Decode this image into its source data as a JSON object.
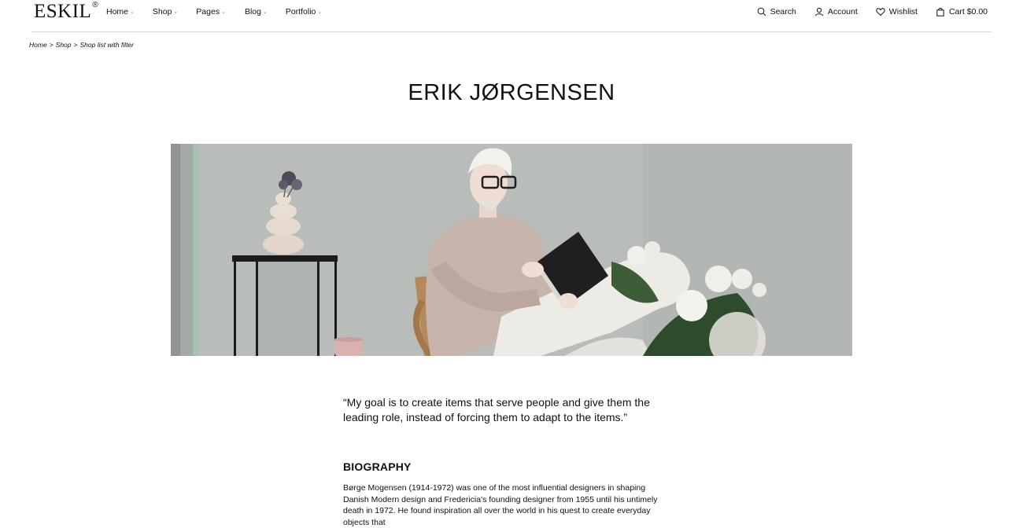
{
  "header": {
    "logo": "ESKIL",
    "logo_mark": "®",
    "nav": [
      {
        "label": "Home"
      },
      {
        "label": "Shop"
      },
      {
        "label": "Pages"
      },
      {
        "label": "Blog"
      },
      {
        "label": "Portfolio"
      }
    ],
    "utility": {
      "search": "Search",
      "account": "Account",
      "wishlist": "Wishlist",
      "cart": "Cart $0.00"
    }
  },
  "breadcrumb": [
    "Home",
    "Shop",
    "Shop list with filter"
  ],
  "breadcrumb_separator": ">",
  "page": {
    "title": "ERIK JØRGENSEN",
    "quote": "“My goal is to create items that serve people and give them the leading role, instead of forcing them to adapt to the items.”",
    "bio_heading": "BIOGRAPHY",
    "bio_text": "Børge Mogensen (1914-1972) was one of the most influential designers in shaping Danish Modern design and Fredericia's founding designer from 1955 until his untimely death in 1972. He found inspiration all over the world in his quest to create everyday objects that"
  },
  "colors": {
    "text": "#111111",
    "rule": "#d9d9d9",
    "hero_wall": "#b7bcb8"
  },
  "icons": [
    "search-icon",
    "account-icon",
    "heart-icon",
    "bag-icon",
    "chevron-down-icon"
  ]
}
